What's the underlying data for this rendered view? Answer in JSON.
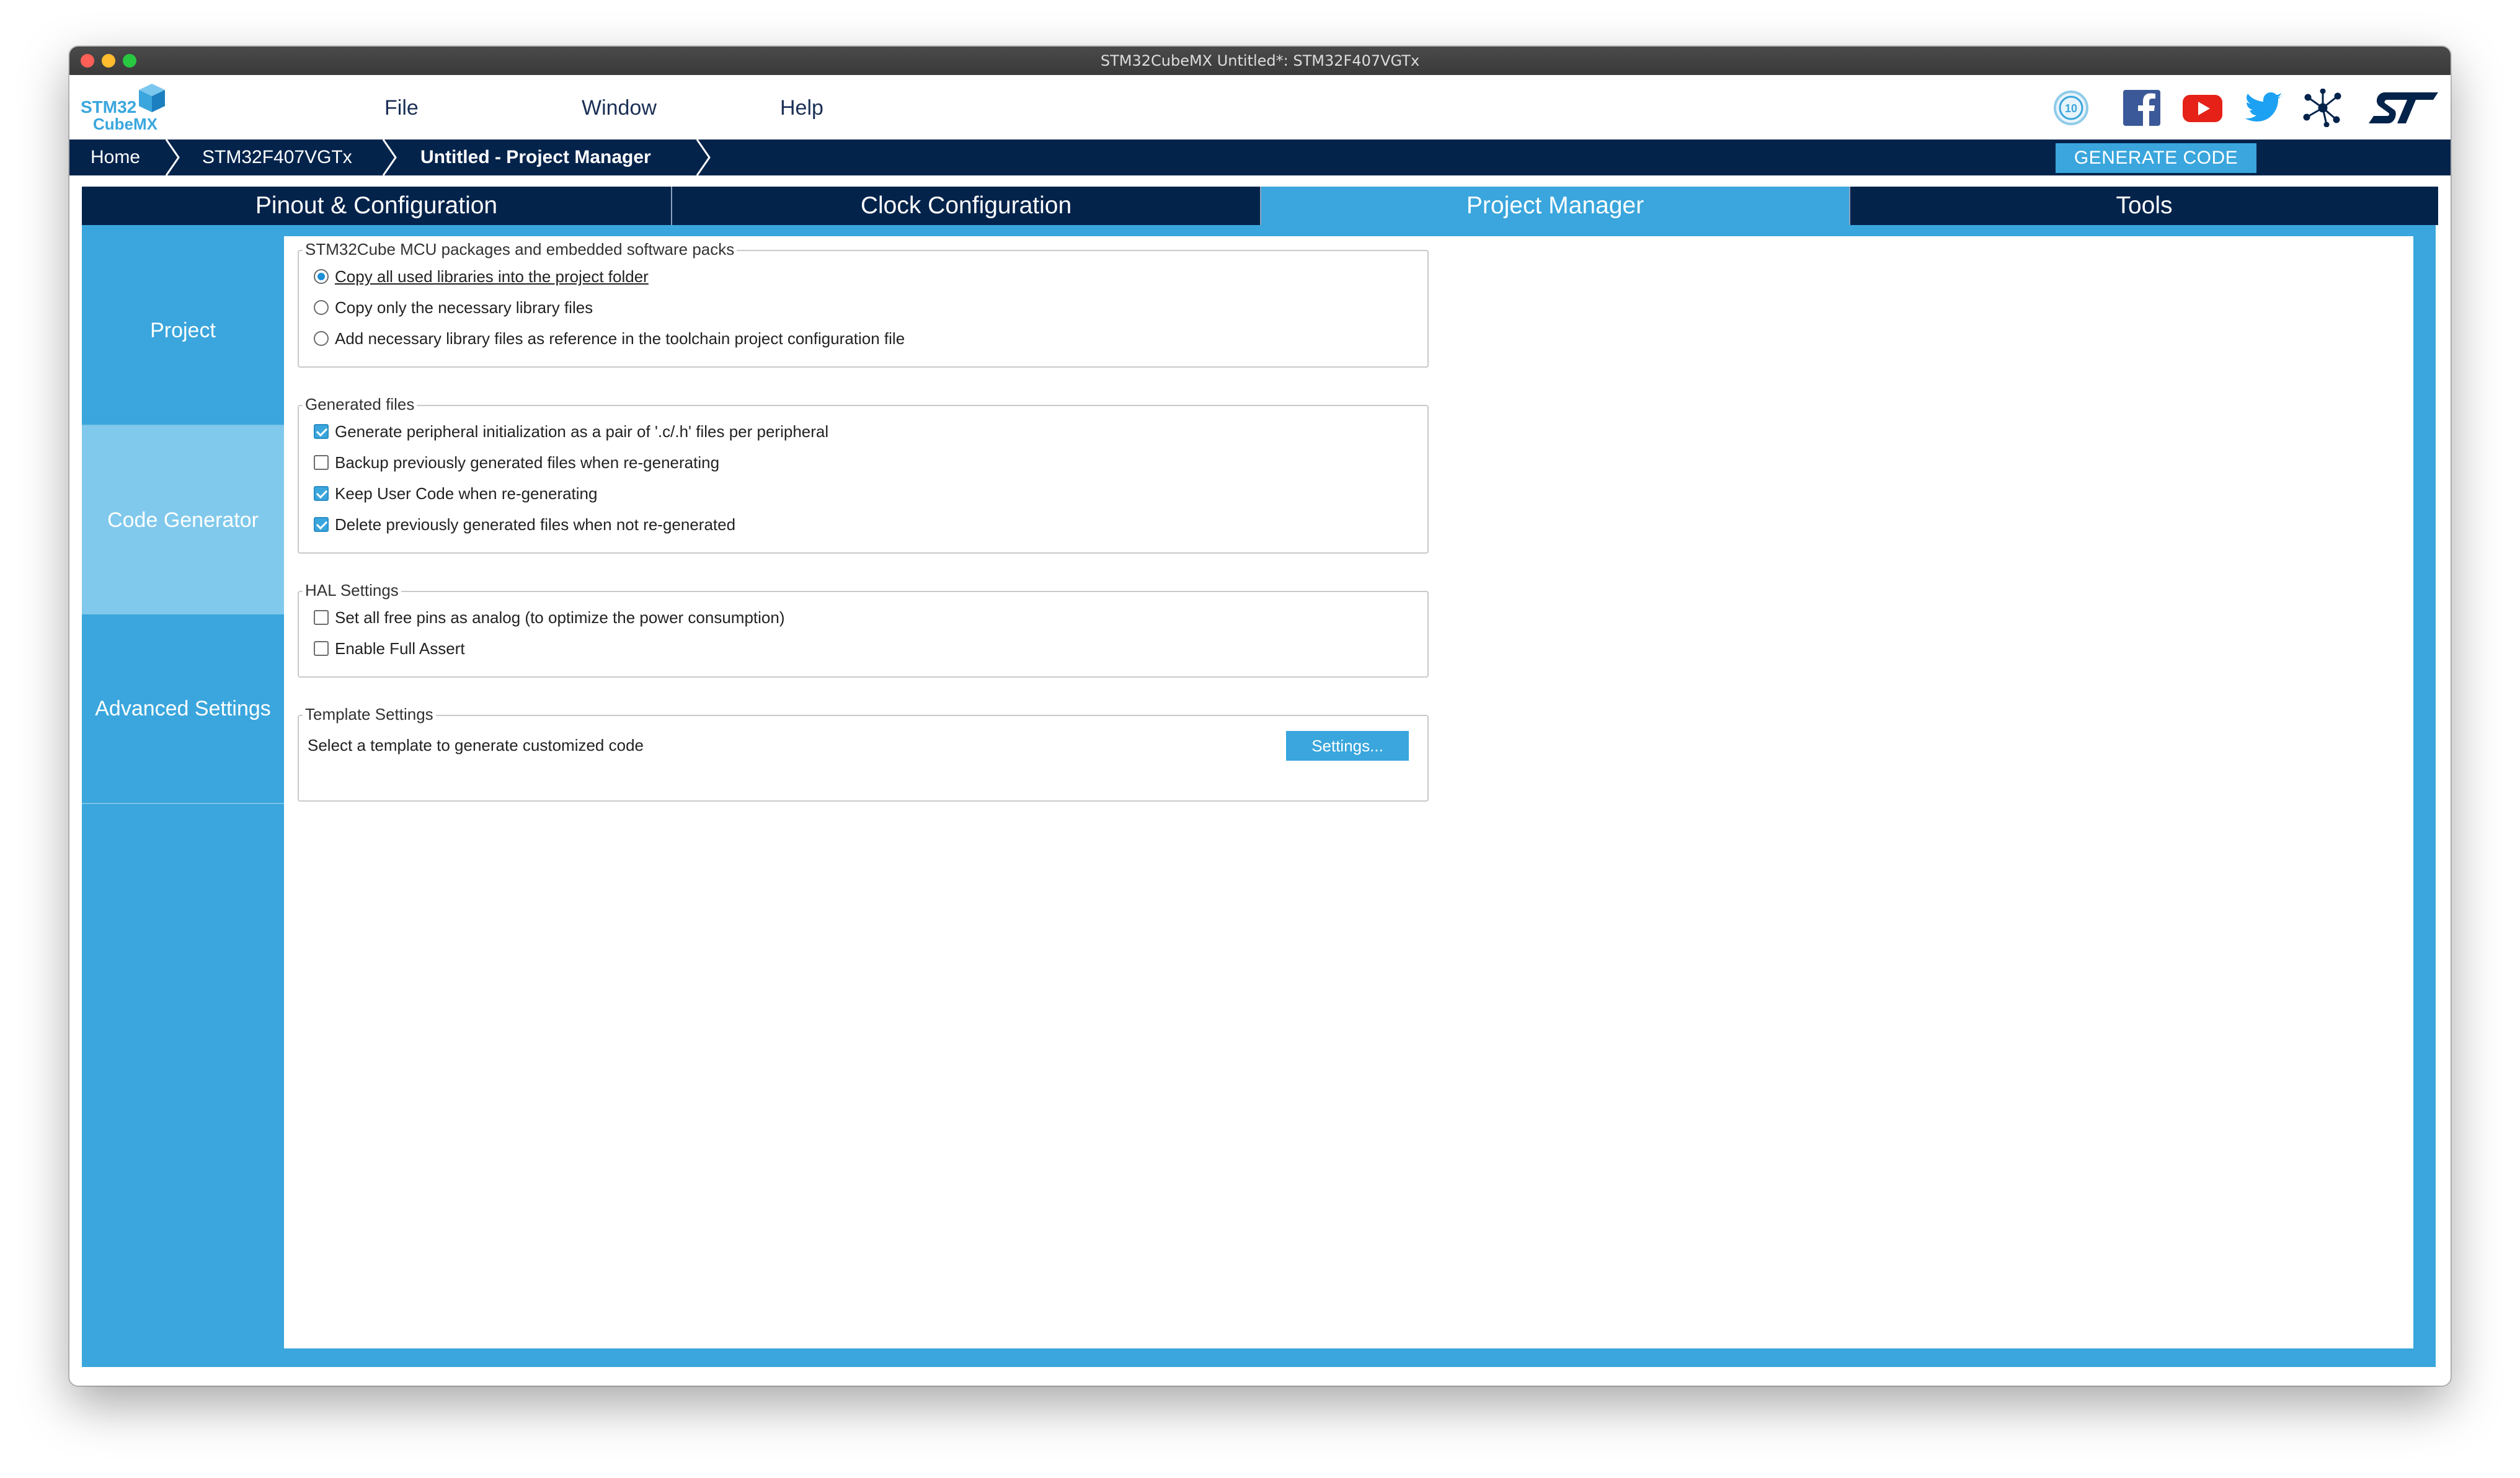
{
  "window": {
    "title": "STM32CubeMX Untitled*: STM32F407VGTx"
  },
  "logo": {
    "line1": "STM32",
    "line2": "CubeMX"
  },
  "menu": {
    "file": "File",
    "window": "Window",
    "help": "Help"
  },
  "breadcrumb": {
    "home": "Home",
    "mcu": "STM32F407VGTx",
    "project": "Untitled - Project Manager"
  },
  "generate_button": "GENERATE CODE",
  "tabs": [
    {
      "label": "Pinout & Configuration",
      "active": false
    },
    {
      "label": "Clock Configuration",
      "active": false
    },
    {
      "label": "Project Manager",
      "active": true
    },
    {
      "label": "Tools",
      "active": false
    }
  ],
  "sidebar": [
    {
      "label": "Project",
      "active": false
    },
    {
      "label": "Code Generator",
      "active": true
    },
    {
      "label": "Advanced Settings",
      "active": false
    }
  ],
  "packages": {
    "legend": "STM32Cube MCU packages and embedded software packs",
    "options": [
      {
        "label": "Copy all used libraries into the project folder",
        "selected": true
      },
      {
        "label": "Copy only the necessary library files",
        "selected": false
      },
      {
        "label": "Add necessary library files as reference in the toolchain project configuration file",
        "selected": false
      }
    ]
  },
  "generated_files": {
    "legend": "Generated files",
    "options": [
      {
        "label": "Generate peripheral initialization as a pair of '.c/.h' files per peripheral",
        "checked": true
      },
      {
        "label": "Backup previously generated files when re-generating",
        "checked": false
      },
      {
        "label": "Keep User Code when re-generating",
        "checked": true
      },
      {
        "label": "Delete previously generated files when not re-generated",
        "checked": true
      }
    ]
  },
  "hal_settings": {
    "legend": "HAL Settings",
    "options": [
      {
        "label": "Set all free pins as analog (to optimize the power consumption)",
        "checked": false
      },
      {
        "label": "Enable Full Assert",
        "checked": false
      }
    ]
  },
  "template_settings": {
    "legend": "Template Settings",
    "text": "Select a template to generate customized code",
    "button": "Settings..."
  },
  "social_icons": [
    "anniversary-icon",
    "facebook-icon",
    "youtube-icon",
    "twitter-icon",
    "network-icon",
    "st-logo-icon"
  ],
  "colors": {
    "navy": "#03234b",
    "accent": "#3aa6dd",
    "sidebar_active": "#80c9ec"
  }
}
